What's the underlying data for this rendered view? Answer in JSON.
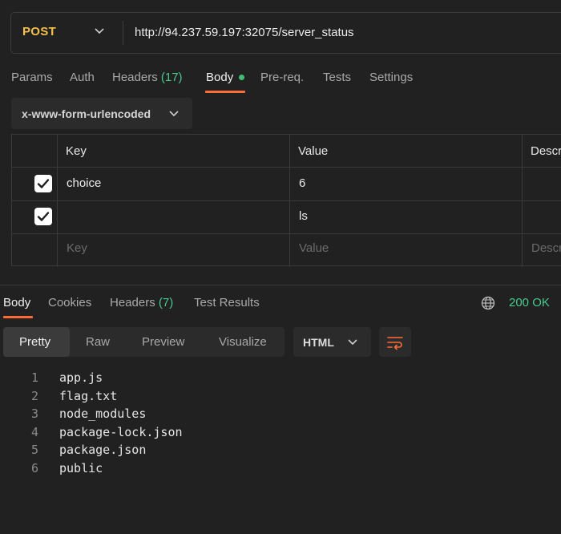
{
  "request": {
    "method": "POST",
    "url": "http://94.237.59.197:32075/server_status"
  },
  "request_tabs": [
    {
      "label": "Params",
      "count": ""
    },
    {
      "label": "Auth",
      "count": ""
    },
    {
      "label": "Headers",
      "count": "(17)"
    },
    {
      "label": "Body",
      "count": ""
    },
    {
      "label": "Pre-req.",
      "count": ""
    },
    {
      "label": "Tests",
      "count": ""
    },
    {
      "label": "Settings",
      "count": ""
    }
  ],
  "body_type": "x-www-form-urlencoded",
  "params_table": {
    "headers": [
      "Key",
      "Value",
      "Descr"
    ],
    "rows": [
      {
        "checked": true,
        "key": "choice",
        "value": "6"
      },
      {
        "checked": true,
        "key": "",
        "value": "ls"
      }
    ],
    "placeholders": {
      "key": "Key",
      "value": "Value",
      "description": "Descr"
    }
  },
  "response_tabs": [
    {
      "label": "Body",
      "count": ""
    },
    {
      "label": "Cookies",
      "count": ""
    },
    {
      "label": "Headers",
      "count": "(7)"
    },
    {
      "label": "Test Results",
      "count": ""
    }
  ],
  "status": "200 OK",
  "format_tabs": [
    "Pretty",
    "Raw",
    "Preview",
    "Visualize"
  ],
  "language": "HTML",
  "output_lines": [
    {
      "n": "1",
      "text": "app.js"
    },
    {
      "n": "2",
      "text": "flag.txt"
    },
    {
      "n": "3",
      "text": "node_modules"
    },
    {
      "n": "4",
      "text": "package-lock.json"
    },
    {
      "n": "5",
      "text": "package.json"
    },
    {
      "n": "6",
      "text": "public"
    }
  ],
  "colors": {
    "accent": "#ff6c37",
    "success": "#49c98d",
    "method": "#f5c04a",
    "background": "#212121"
  },
  "icons": [
    "chevron-down-icon",
    "globe-icon",
    "wrap-lines-icon",
    "check-icon"
  ]
}
